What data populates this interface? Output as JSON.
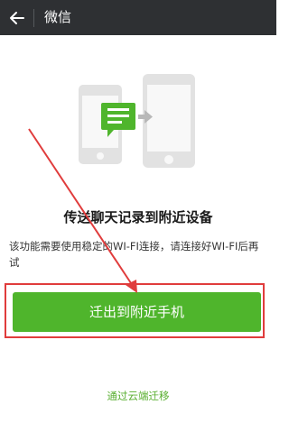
{
  "header": {
    "title": "微信",
    "back_icon": "arrow-left-icon"
  },
  "illustration": {
    "icon": "phone-to-phone-transfer-icon",
    "accent": "#4fb52c"
  },
  "main": {
    "headline": "传送聊天记录到附近设备",
    "description": "该功能需要使用稳定的WI-FI连接，请连接好WI-FI后再试",
    "primary_button": "迁出到附近手机",
    "cloud_link": "通过云端迁移"
  },
  "annotation": {
    "color": "#e03c3c"
  }
}
